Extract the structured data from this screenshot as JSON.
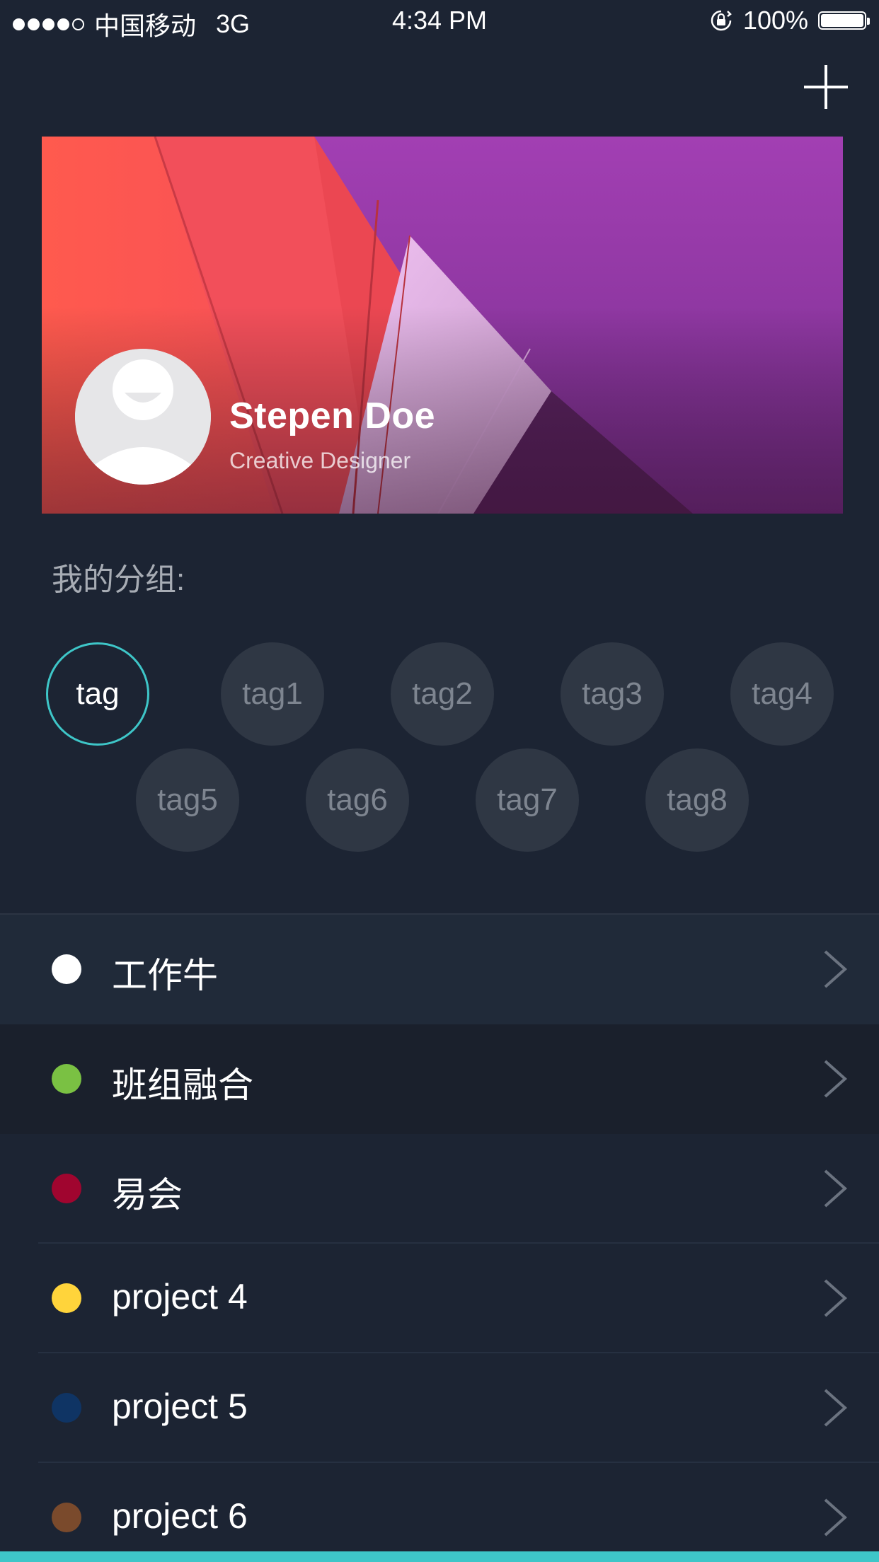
{
  "status_bar": {
    "carrier": "中国移动",
    "network": "3G",
    "time": "4:34 PM",
    "battery": "100%"
  },
  "header": {
    "add_icon": "plus-icon"
  },
  "profile": {
    "name": "Stepen Doe",
    "role": "Creative Designer",
    "avatar_icon": "user-avatar-icon"
  },
  "groups": {
    "label": "我的分组:",
    "accent_color": "#3ec6c8",
    "tags": [
      {
        "label": "tag",
        "active": true
      },
      {
        "label": "tag1",
        "active": false
      },
      {
        "label": "tag2",
        "active": false
      },
      {
        "label": "tag3",
        "active": false
      },
      {
        "label": "tag4",
        "active": false
      },
      {
        "label": "tag5",
        "active": false
      },
      {
        "label": "tag6",
        "active": false
      },
      {
        "label": "tag7",
        "active": false
      },
      {
        "label": "tag8",
        "active": false
      }
    ]
  },
  "projects": [
    {
      "label": "工作牛",
      "color": "#ffffff"
    },
    {
      "label": "班组融合",
      "color": "#7ac143"
    },
    {
      "label": "易会",
      "color": "#a0052f"
    },
    {
      "label": "project 4",
      "color": "#ffd43b"
    },
    {
      "label": "project 5",
      "color": "#0f3464"
    },
    {
      "label": "project 6",
      "color": "#7a4a2c"
    }
  ]
}
